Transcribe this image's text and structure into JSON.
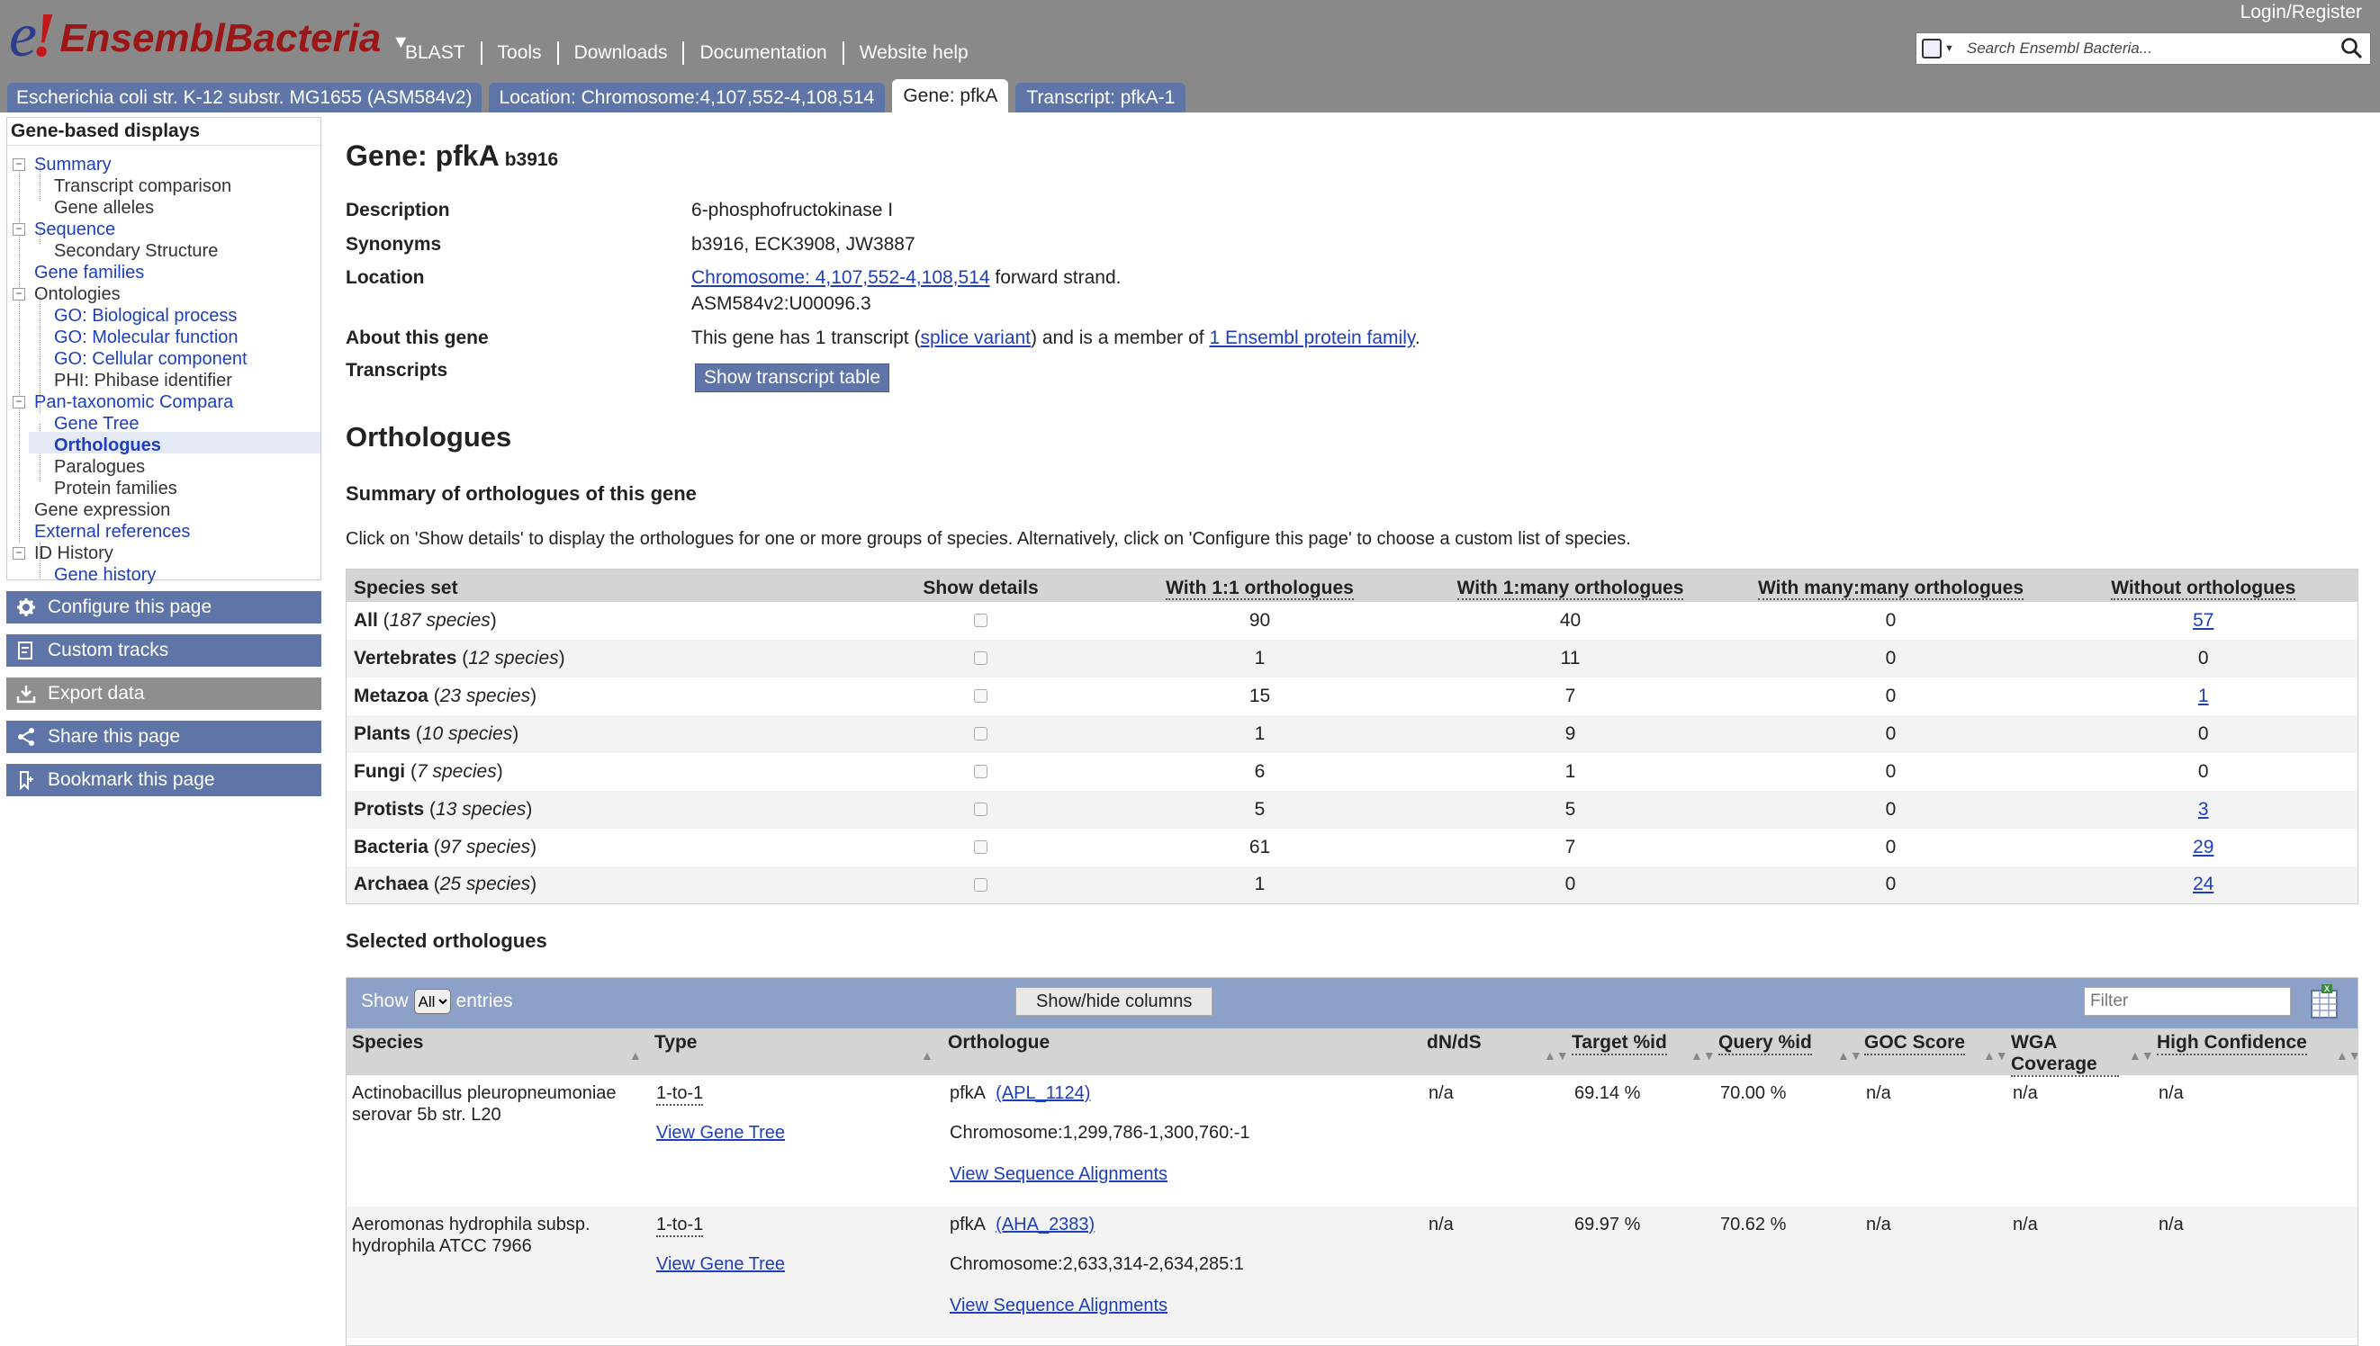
{
  "masthead": {
    "logo_e": "e",
    "logo_bang": "!",
    "logo_name": "EnsemblBacteria",
    "nav": [
      "BLAST",
      "Tools",
      "Downloads",
      "Documentation",
      "Website help"
    ],
    "login": "Login/Register",
    "search_placeholder": "Search Ensembl Bacteria..."
  },
  "tabs": [
    {
      "label": "Escherichia coli str. K-12 substr. MG1655 (ASM584v2)"
    },
    {
      "label": "Location: Chromosome:4,107,552-4,108,514"
    },
    {
      "label": "Gene: pfkA"
    },
    {
      "label": "Transcript: pfkA-1"
    }
  ],
  "sidebar": {
    "heading": "Gene-based displays",
    "items": [
      {
        "label": "Summary"
      },
      {
        "label": "Transcript comparison"
      },
      {
        "label": "Gene alleles"
      },
      {
        "label": "Sequence"
      },
      {
        "label": "Secondary Structure"
      },
      {
        "label": "Gene families"
      },
      {
        "label": "Ontologies"
      },
      {
        "label": "GO: Biological process"
      },
      {
        "label": "GO: Molecular function"
      },
      {
        "label": "GO: Cellular component"
      },
      {
        "label": "PHI: Phibase identifier"
      },
      {
        "label": "Pan-taxonomic Compara"
      },
      {
        "label": "Gene Tree"
      },
      {
        "label": "Orthologues"
      },
      {
        "label": "Paralogues"
      },
      {
        "label": "Protein families"
      },
      {
        "label": "Gene expression"
      },
      {
        "label": "External references"
      },
      {
        "label": "ID History"
      },
      {
        "label": "Gene history"
      }
    ],
    "buttons": [
      {
        "label": "Configure this page"
      },
      {
        "label": "Custom tracks"
      },
      {
        "label": "Export data"
      },
      {
        "label": "Share this page"
      },
      {
        "label": "Bookmark this page"
      }
    ]
  },
  "gene": {
    "title": "Gene: pfkA",
    "id": "b3916",
    "labels": {
      "description": "Description",
      "synonyms": "Synonyms",
      "location": "Location",
      "about": "About this gene",
      "transcripts": "Transcripts"
    },
    "description": "6-phosphofructokinase I",
    "synonyms": "b3916, ECK3908, JW3887",
    "location_link": "Chromosome: 4,107,552-4,108,514",
    "location_strand": " forward strand.",
    "location_assembly": "ASM584v2:U00096.3",
    "about_pre": "This gene has 1 transcript (",
    "about_link1": "splice variant",
    "about_mid": ") and is a member of ",
    "about_link2": "1 Ensembl protein family",
    "about_post": ".",
    "transcript_button": "Show transcript table"
  },
  "orthologues": {
    "title": "Orthologues",
    "summary_title": "Summary of orthologues of this gene",
    "instruction": "Click on 'Show details' to display the orthologues for one or more groups of species. Alternatively, click on 'Configure this page' to choose a custom list of species.",
    "summary_headers": [
      "Species set",
      "Show details",
      "With 1:1 orthologues",
      "With 1:many orthologues",
      "With many:many orthologues",
      "Without orthologues"
    ],
    "summary_rows": [
      {
        "set": "All",
        "species": "187 species",
        "one": "90",
        "many": "40",
        "manymany": "0",
        "without": "57",
        "without_link": true
      },
      {
        "set": "Vertebrates",
        "species": "12 species",
        "one": "1",
        "many": "11",
        "manymany": "0",
        "without": "0",
        "without_link": false
      },
      {
        "set": "Metazoa",
        "species": "23 species",
        "one": "15",
        "many": "7",
        "manymany": "0",
        "without": "1",
        "without_link": true
      },
      {
        "set": "Plants",
        "species": "10 species",
        "one": "1",
        "many": "9",
        "manymany": "0",
        "without": "0",
        "without_link": false
      },
      {
        "set": "Fungi",
        "species": "7 species",
        "one": "6",
        "many": "1",
        "manymany": "0",
        "without": "0",
        "without_link": false
      },
      {
        "set": "Protists",
        "species": "13 species",
        "one": "5",
        "many": "5",
        "manymany": "0",
        "without": "3",
        "without_link": true
      },
      {
        "set": "Bacteria",
        "species": "97 species",
        "one": "61",
        "many": "7",
        "manymany": "0",
        "without": "29",
        "without_link": true
      },
      {
        "set": "Archaea",
        "species": "25 species",
        "one": "1",
        "many": "0",
        "manymany": "0",
        "without": "24",
        "without_link": true
      }
    ],
    "selected_title": "Selected orthologues",
    "show_label": "Show",
    "show_value": "All",
    "entries_label": "entries",
    "showhide_button": "Show/hide columns",
    "filter_placeholder": "Filter",
    "selected_headers": [
      "Species",
      "Type",
      "Orthologue",
      "dN/dS",
      "Target %id",
      "Query %id",
      "GOC Score",
      "WGA Coverage",
      "High Confidence"
    ],
    "selected_rows": [
      {
        "species": "Actinobacillus pleuropneumoniae serovar 5b str. L20",
        "type": "1-to-1",
        "gene_tree": "View Gene Tree",
        "orth_name": "pfkA",
        "orth_id": "(APL_1124)",
        "orth_loc": "Chromosome:1,299,786-1,300,760:-1",
        "alignments": "View Sequence Alignments",
        "dnds": "n/a",
        "target": "69.14 %",
        "query": "70.00 %",
        "goc": "n/a",
        "wga": "n/a",
        "high": "n/a"
      },
      {
        "species": "Aeromonas hydrophila subsp. hydrophila ATCC 7966",
        "type": "1-to-1",
        "gene_tree": "View Gene Tree",
        "orth_name": "pfkA",
        "orth_id": "(AHA_2383)",
        "orth_loc": "Chromosome:2,633,314-2,634,285:1",
        "alignments": "View Sequence Alignments",
        "dnds": "n/a",
        "target": "69.97 %",
        "query": "70.62 %",
        "goc": "n/a",
        "wga": "n/a",
        "high": "n/a"
      }
    ]
  },
  "colors": {
    "masthead": "#898989",
    "tab": "#5f75a8",
    "link": "#1e3fb8",
    "logo_red": "#9b1617",
    "table_bar": "#8da0c8"
  }
}
